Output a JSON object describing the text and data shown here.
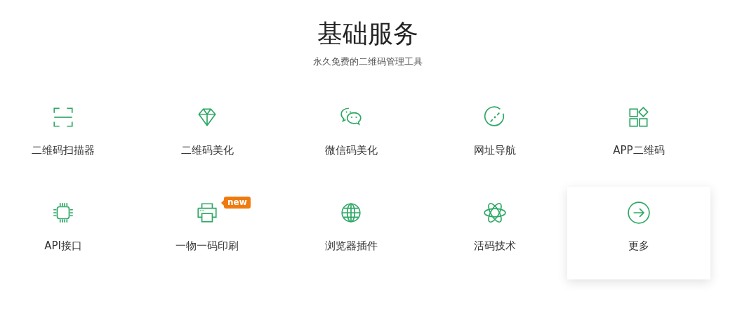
{
  "header": {
    "title": "基础服务",
    "subtitle": "永久免费的二维码管理工具"
  },
  "services": [
    {
      "label": "二维码扫描器",
      "highlighted": false
    },
    {
      "label": "二维码美化",
      "highlighted": false
    },
    {
      "label": "微信码美化",
      "highlighted": false
    },
    {
      "label": "网址导航",
      "highlighted": false
    },
    {
      "label": "APP二维码",
      "highlighted": false
    },
    {
      "label": "API接口",
      "highlighted": false
    },
    {
      "label": "一物一码印刷",
      "highlighted": false,
      "badge": "new"
    },
    {
      "label": "浏览器插件",
      "highlighted": false
    },
    {
      "label": "活码技术",
      "highlighted": false
    },
    {
      "label": "更多",
      "highlighted": true
    }
  ]
}
